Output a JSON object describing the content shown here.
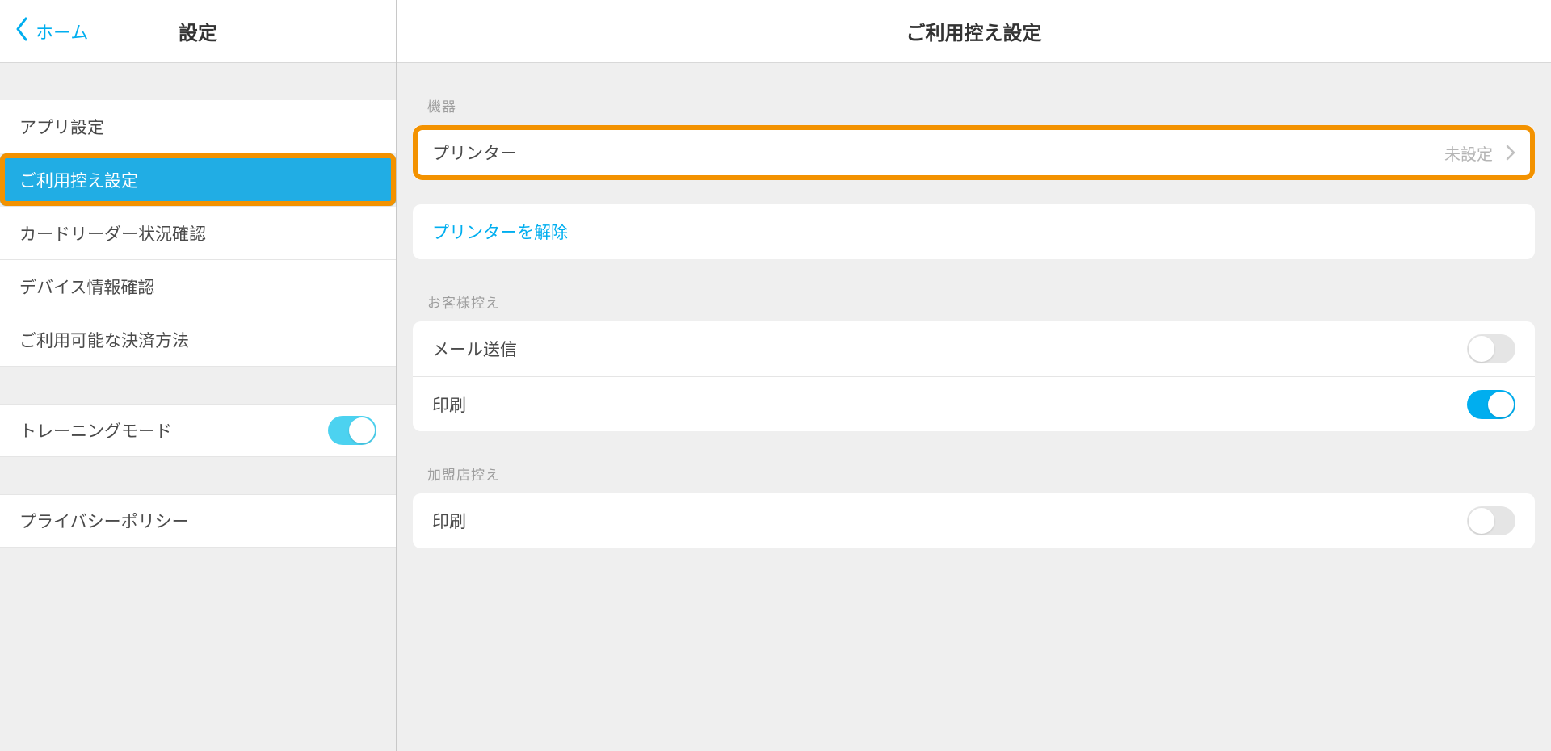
{
  "left": {
    "back_label": "ホーム",
    "title": "設定",
    "group1": [
      "アプリ設定",
      "ご利用控え設定",
      "カードリーダー状況確認",
      "デバイス情報確認",
      "ご利用可能な決済方法"
    ],
    "training_label": "トレーニングモード",
    "training_on": true,
    "privacy_label": "プライバシーポリシー"
  },
  "right": {
    "title": "ご利用控え設定",
    "section_device": "機器",
    "printer_label": "プリンター",
    "printer_value": "未設定",
    "release_printer": "プリンターを解除",
    "section_customer": "お客様控え",
    "mail_label": "メール送信",
    "mail_on": false,
    "print_label": "印刷",
    "print_on": true,
    "section_merchant": "加盟店控え",
    "merchant_print_label": "印刷",
    "merchant_print_on": false
  }
}
